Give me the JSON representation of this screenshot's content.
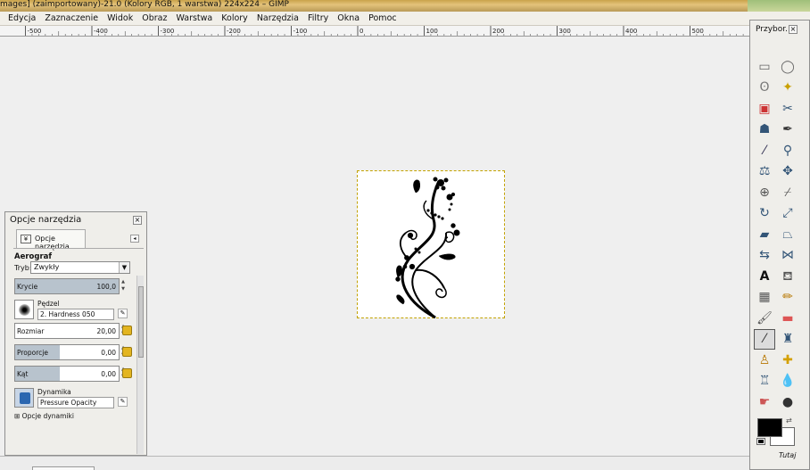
{
  "window": {
    "title": "mages] (zaimportowany)-21.0 (Kolory RGB, 1 warstwa) 224x224 – GIMP"
  },
  "menu": [
    {
      "label": "Edycja"
    },
    {
      "label": "Zaznaczenie"
    },
    {
      "label": "Widok"
    },
    {
      "label": "Obraz"
    },
    {
      "label": "Warstwa"
    },
    {
      "label": "Kolory"
    },
    {
      "label": "Narzędzia"
    },
    {
      "label": "Filtry"
    },
    {
      "label": "Okna"
    },
    {
      "label": "Pomoc"
    }
  ],
  "ruler": {
    "ticks": [
      "-500",
      "-400",
      "-300",
      "-200",
      "-100",
      "0",
      "100",
      "200",
      "300",
      "400",
      "500"
    ]
  },
  "tool_options": {
    "title": "Opcje narzędzia",
    "tab_label": "Opcje narzędzia",
    "tool_name": "Aerograf",
    "mode_label": "Tryb:",
    "mode_value": "Zwykły",
    "opacity_label": "Krycie",
    "opacity_value": "100,0",
    "opacity_level": 1.0,
    "brush_label": "Pędzel",
    "brush_value": "2. Hardness 050",
    "size_label": "Rozmiar",
    "size_value": "20,00",
    "aspect_label": "Proporcje",
    "aspect_value": "0,00",
    "angle_label": "Kąt",
    "angle_value": "0,00",
    "dynamics_label": "Dynamika",
    "dynamics_value": "Pressure Opacity",
    "dynamics_options_label": "Opcje dynamiki"
  },
  "toolbox": {
    "title": "Przybor...",
    "here_label": "Tutaj",
    "fg_color": "#000000",
    "bg_color": "#ffffff"
  },
  "icons": {
    "close": "close-icon",
    "tab_menu": "tab-menu-icon",
    "dropdown": "chevron-down-icon",
    "reset": "reset-icon",
    "edit": "edit-icon"
  }
}
